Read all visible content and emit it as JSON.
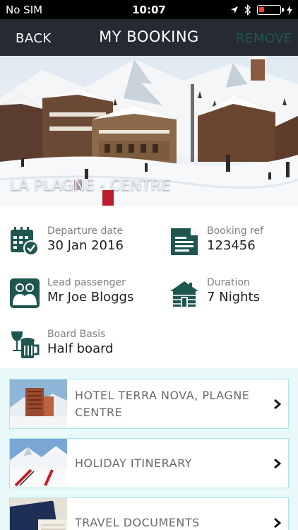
{
  "status_bar": {
    "carrier": "No SIM",
    "time": "10:07"
  },
  "nav": {
    "back": "BACK",
    "title": "MY BOOKING",
    "remove": "REMOVE"
  },
  "hero": {
    "caption": "LA PLAGNE - CENTRE"
  },
  "details": {
    "departure": {
      "label": "Departure date",
      "value": "30 Jan 2016"
    },
    "booking_ref": {
      "label": "Booking ref",
      "value": "123456"
    },
    "lead_passenger": {
      "label": "Lead passenger",
      "value": "Mr Joe Bloggs"
    },
    "duration": {
      "label": "Duration",
      "value": "7 Nights"
    },
    "board_basis": {
      "label": "Board Basis",
      "value": "Half board"
    }
  },
  "links": [
    {
      "label": "HOTEL TERRA NOVA, PLAGNE CENTRE"
    },
    {
      "label": "HOLIDAY ITINERARY"
    },
    {
      "label": "TRAVEL DOCUMENTS"
    }
  ],
  "colors": {
    "teal": "#1f5650",
    "nav_bg": "#252a33",
    "accent_border": "#a6e7e7"
  }
}
